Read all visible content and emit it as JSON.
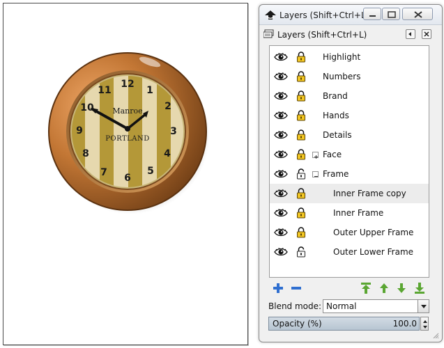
{
  "canvas": {
    "clock": {
      "brand_top": "Manroe",
      "brand_bottom": "PORTLAND",
      "numerals": [
        "12",
        "1",
        "2",
        "3",
        "4",
        "5",
        "6",
        "7",
        "8",
        "9",
        "10",
        "11"
      ]
    }
  },
  "window": {
    "title": "Layers (Shift+Ctrl+L)",
    "controls": {
      "minimize": "minimize",
      "maximize": "maximize",
      "close": "close"
    }
  },
  "dock": {
    "title": "Layers (Shift+Ctrl+L)"
  },
  "layers": [
    {
      "name": "Highlight",
      "visible": true,
      "locked": true,
      "expander": "",
      "selected": false
    },
    {
      "name": "Numbers",
      "visible": true,
      "locked": true,
      "expander": "",
      "selected": false
    },
    {
      "name": "Brand",
      "visible": true,
      "locked": true,
      "expander": "",
      "selected": false
    },
    {
      "name": "Hands",
      "visible": true,
      "locked": true,
      "expander": "",
      "selected": false
    },
    {
      "name": "Details",
      "visible": true,
      "locked": true,
      "expander": "",
      "selected": false
    },
    {
      "name": "Face",
      "visible": true,
      "locked": true,
      "expander": "+",
      "selected": false
    },
    {
      "name": "Frame",
      "visible": true,
      "locked": false,
      "expander": "−",
      "selected": false
    },
    {
      "name": "Inner Frame copy",
      "visible": true,
      "locked": true,
      "expander": "",
      "selected": true
    },
    {
      "name": "Inner Frame",
      "visible": true,
      "locked": true,
      "expander": "",
      "selected": false
    },
    {
      "name": "Outer Upper Frame",
      "visible": true,
      "locked": true,
      "expander": "",
      "selected": false
    },
    {
      "name": "Outer Lower Frame",
      "visible": true,
      "locked": false,
      "expander": "",
      "selected": false
    }
  ],
  "toolbar": {
    "icons": [
      "add-layer-icon",
      "remove-layer-icon",
      "raise-to-top-icon",
      "raise-layer-icon",
      "lower-layer-icon",
      "lower-to-bottom-icon"
    ]
  },
  "blend": {
    "label": "Blend mode:",
    "value": "Normal"
  },
  "opacity": {
    "label": "Opacity (%)",
    "value": "100.0"
  },
  "colors": {
    "accent": "#6c9ac4",
    "icon_green": "#5aa632",
    "icon_blue": "#2f6fd0",
    "clock_rim": "#b06c2c",
    "clock_stripe": "#b49838",
    "clock_face": "#e6d8ae"
  }
}
